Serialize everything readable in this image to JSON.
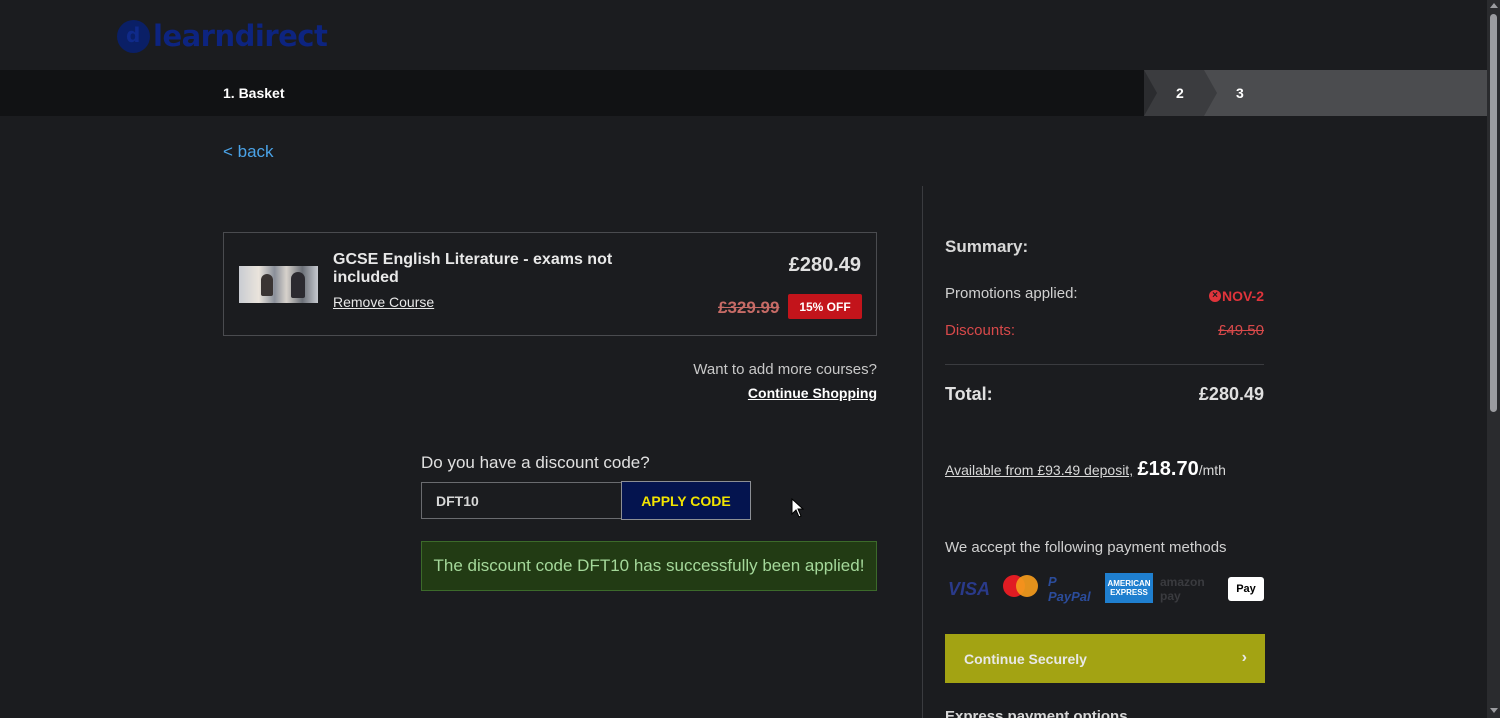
{
  "header": {
    "logo_text": "learndirect",
    "logo_mark": "d"
  },
  "steps": {
    "step1": "1. Basket",
    "step2": "2",
    "step3": "3"
  },
  "nav": {
    "back_label": "< back"
  },
  "course": {
    "title": "GCSE English Literature - exams not included",
    "remove_label": "Remove Course",
    "price": "£280.49",
    "old_price": "£329.99",
    "discount_badge": "15% OFF"
  },
  "more": {
    "question": "Want to add more courses?",
    "link": "Continue Shopping"
  },
  "discount": {
    "question": "Do you have a discount code?",
    "input_value": "DFT10",
    "apply_label": "APPLY CODE",
    "success_message": "The discount code DFT10 has successfully been applied!"
  },
  "summary": {
    "title": "Summary:",
    "promotions_label": "Promotions applied:",
    "promotions_value": "NOV-2",
    "discounts_label": "Discounts:",
    "discounts_value": "£49.50",
    "total_label": "Total:",
    "total_value": "£280.49",
    "deposit_link": "Available from £93.49 deposit,",
    "monthly_amount": "£18.70",
    "monthly_suffix": "/mth",
    "payment_title": "We accept the following payment methods",
    "continue_label": "Continue Securely",
    "express_label": "Express payment options"
  },
  "payment_methods": {
    "visa": "VISA",
    "paypal": "P PayPal",
    "amex": "AMERICAN EXPRESS",
    "amazon": "amazon pay",
    "applepay": "Pay"
  },
  "colors": {
    "background": "#1b1c1f",
    "accent_link": "#4aa3e8",
    "apply_button": "#04144f",
    "apply_text": "#f2e400",
    "sale_red": "#c3141b",
    "success_bg": "#223b14",
    "continue_button": "#a3a313"
  }
}
